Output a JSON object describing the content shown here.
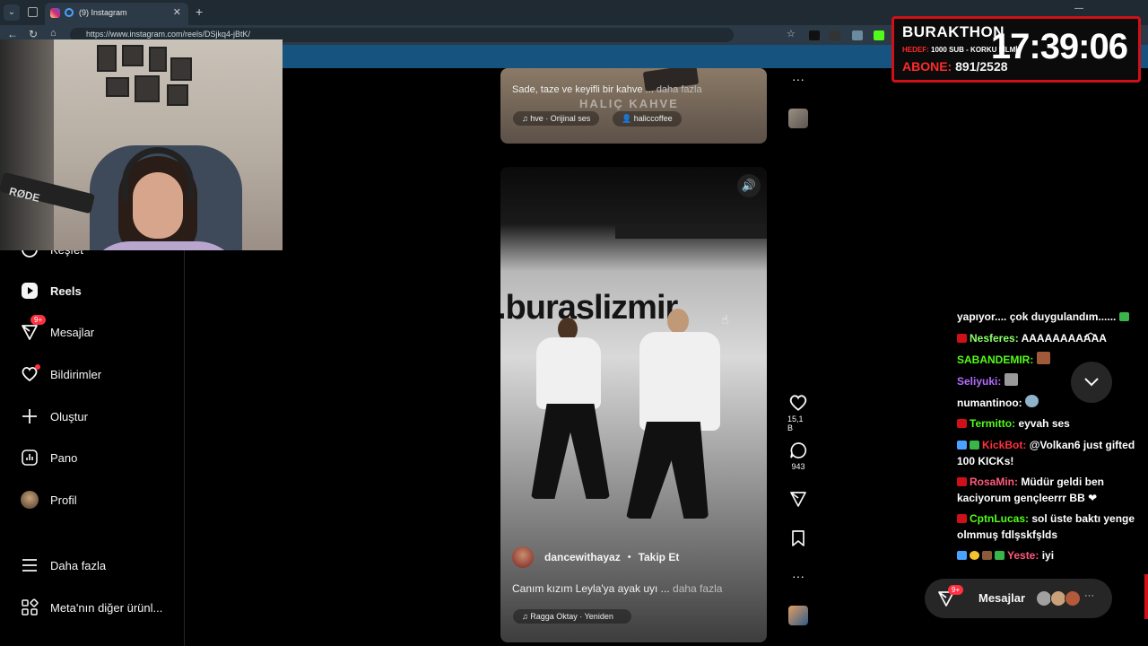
{
  "browser": {
    "tab_title": "(9) Instagram",
    "url": "https://www.instagram.com/reels/DSjkq4-jBtK/"
  },
  "webcam": {
    "mic_brand": "RØDE"
  },
  "nav": {
    "partial_item": "Keşfet",
    "items": [
      {
        "label": "Reels",
        "icon": "reels-icon"
      },
      {
        "label": "Mesajlar",
        "icon": "messenger-icon",
        "badge": "9+"
      },
      {
        "label": "Bildirimler",
        "icon": "heart-icon"
      },
      {
        "label": "Oluştur",
        "icon": "plus-icon"
      },
      {
        "label": "Pano",
        "icon": "dashboard-icon"
      },
      {
        "label": "Profil",
        "icon": "avatar"
      },
      {
        "label": "Daha fazla",
        "icon": "menu-icon"
      },
      {
        "label": "Meta'nın diğer ürünl...",
        "icon": "apps-icon"
      }
    ]
  },
  "reel_top": {
    "caption": "Sade, taze ve keyifli bir kahve ...",
    "more": "daha fazla",
    "watermark": "HALIÇ KAHVE",
    "audio": "hve · Orijinal ses",
    "tag": "haliccoffee"
  },
  "reel_main": {
    "sign": ".buraslizmir",
    "username": "dancewithayaz",
    "follow": "Takip Et",
    "caption": "Canım kızım Leyla'ya ayak uyı ...",
    "more": "daha fazla",
    "audio": "Ragga Oktay · Yeniden"
  },
  "actions": {
    "likes": "15,1 B",
    "comments": "943"
  },
  "overlay": {
    "name": "BURAKTHON",
    "goal_label": "HEDEF:",
    "goal_text": "1000 SUB - KORKU FİLMİ",
    "abone_label": "ABONE:",
    "abone_value": "891/2528",
    "time": "17:39:06"
  },
  "chat": [
    {
      "user": "",
      "text": "yapıyor.... çok duygulandım......",
      "color": "#ffffff"
    },
    {
      "user": "Nesferes:",
      "text": "AAAAAAAAAAA",
      "color": "#8cff6a"
    },
    {
      "user": "SABANDEMIR:",
      "text": "",
      "color": "#53fc18"
    },
    {
      "user": "Seliyuki:",
      "text": "",
      "color": "#b46cff"
    },
    {
      "user": "numantinoo:",
      "text": "",
      "color": "#ffffff"
    },
    {
      "user": "Termitto:",
      "text": "eyvah ses",
      "color": "#53fc18"
    },
    {
      "user": "KickBot:",
      "text": "@Volkan6 just gifted",
      "text2": "100 KICKs!",
      "color": "#ff3040"
    },
    {
      "user": "RosaMin:",
      "text": "Müdür geldi ben",
      "text2": "kaciyorum gençleerrr BB ❤",
      "color": "#ff5a7a"
    },
    {
      "user": "CptnLucas:",
      "text": "sol üste baktı yenge",
      "text2": "olmmuş fdlşskfşlds",
      "color": "#53fc18"
    },
    {
      "user": "Yeste:",
      "text": "iyi",
      "color": "#ff5a7a"
    }
  ],
  "messages_pill": {
    "label": "Mesajlar",
    "badge": "9+"
  }
}
